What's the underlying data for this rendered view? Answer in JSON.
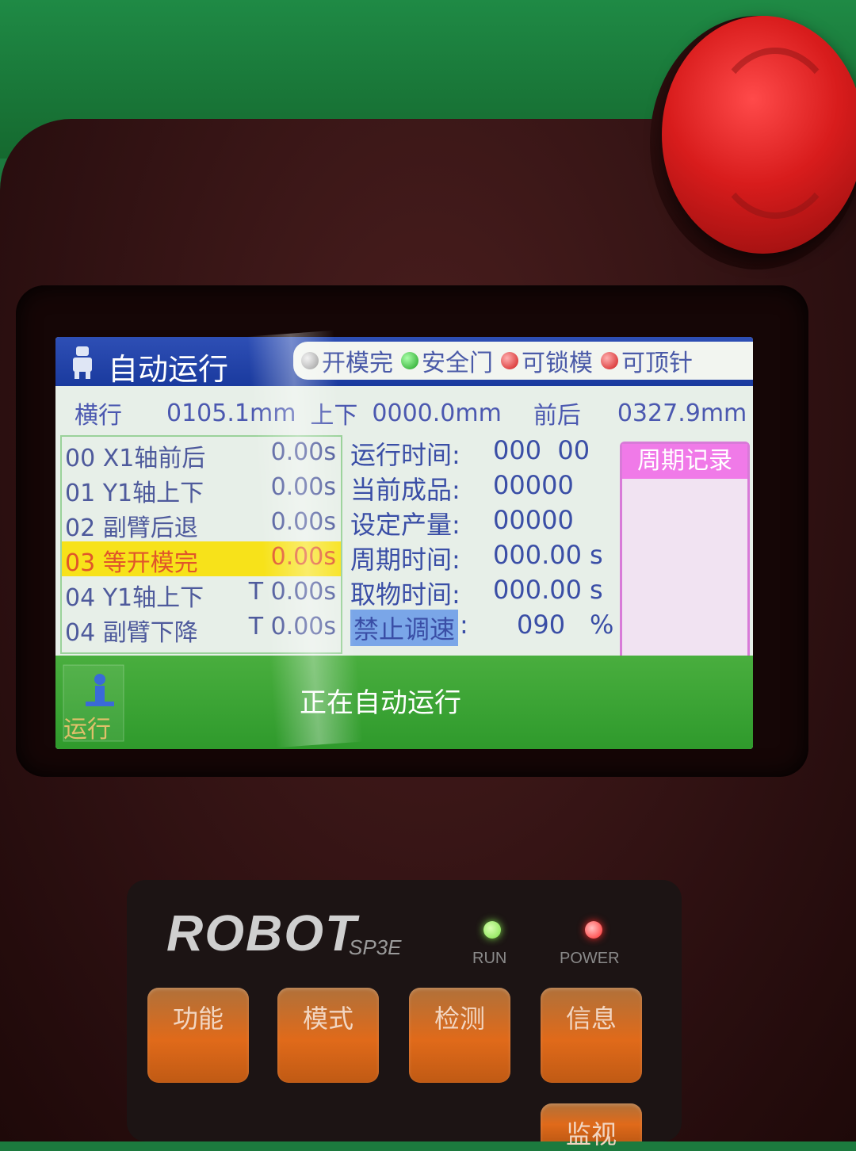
{
  "screen": {
    "title": "自动运行",
    "status_indicators": [
      {
        "label": "开模完",
        "color": "grey"
      },
      {
        "label": "安全门",
        "color": "green"
      },
      {
        "label": "可锁模",
        "color": "red"
      },
      {
        "label": "可顶针",
        "color": "red"
      }
    ],
    "axes": [
      {
        "label": "横行",
        "value": "0105.1mm"
      },
      {
        "label": "上下",
        "value": "0000.0mm"
      },
      {
        "label": "前后",
        "value": "0327.9mm"
      }
    ],
    "steps": [
      {
        "name": "00 X1轴前后",
        "time": "0.00s"
      },
      {
        "name": "01 Y1轴上下",
        "time": "0.00s"
      },
      {
        "name": "02 副臂后退",
        "time": "0.00s"
      },
      {
        "name": "03 等开模完",
        "time": "0.00s",
        "active": true
      },
      {
        "name": "04 Y1轴上下",
        "time": "T 0.00s"
      },
      {
        "name": "04 副臂下降",
        "time": "T 0.00s"
      }
    ],
    "info": {
      "run_time_label": "运行时间:",
      "run_time_value": "000  00",
      "current_product_label": "当前成品:",
      "current_product_value": "00000",
      "set_output_label": "设定产量:",
      "set_output_value": "00000",
      "cycle_time_label": "周期时间:",
      "cycle_time_value": "000.00",
      "cycle_time_unit": "s",
      "pick_time_label": "取物时间:",
      "pick_time_value": "000.00",
      "pick_time_unit": "s",
      "speed_label": "禁止调速",
      "speed_colon": ":",
      "speed_value": "090",
      "speed_unit": "%"
    },
    "cycle_record_title": "周期记录",
    "run_button_label": "运行",
    "run_status": "正在自动运行"
  },
  "device": {
    "brand": "ROBOT",
    "model": "SP3E",
    "run_indicator": "RUN",
    "power_indicator": "POWER",
    "keys": [
      "功能",
      "模式",
      "检测",
      "信息",
      "监视"
    ]
  },
  "colors": {
    "title_bar": "#1a3a9e",
    "active_step_bg": "#f7e21a",
    "bottom_bar": "#3aa335",
    "record_panel": "#f07ae8",
    "run_led": "#7fe04a",
    "power_led": "#ff2a2a"
  }
}
